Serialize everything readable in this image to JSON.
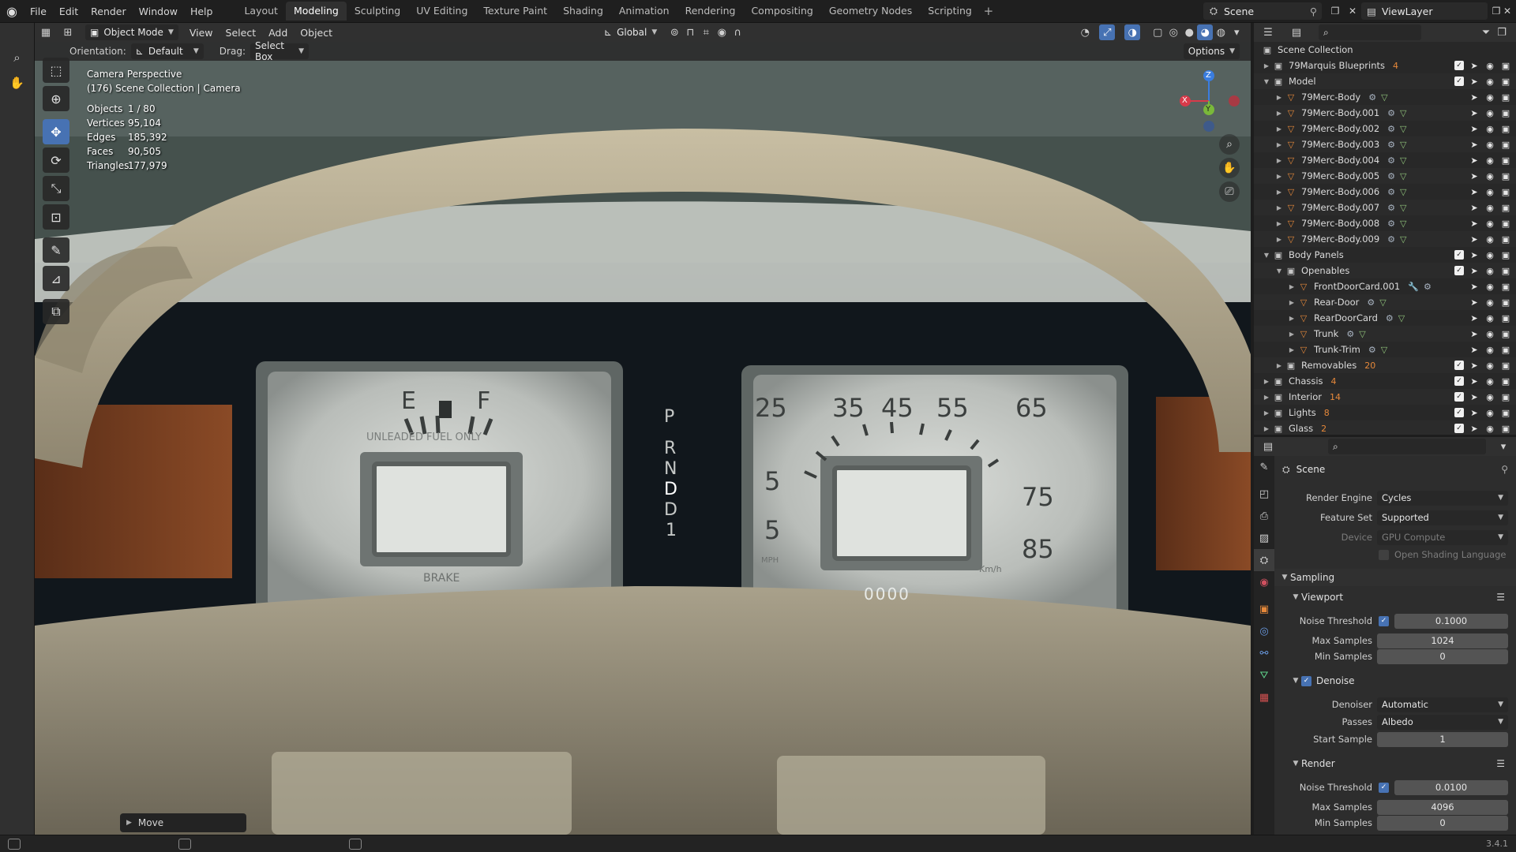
{
  "topbar": {
    "menus": [
      "File",
      "Edit",
      "Render",
      "Window",
      "Help"
    ],
    "workspaces": [
      {
        "label": "Layout",
        "active": false
      },
      {
        "label": "Modeling",
        "active": true
      },
      {
        "label": "Sculpting",
        "active": false
      },
      {
        "label": "UV Editing",
        "active": false
      },
      {
        "label": "Texture Paint",
        "active": false
      },
      {
        "label": "Shading",
        "active": false
      },
      {
        "label": "Animation",
        "active": false
      },
      {
        "label": "Rendering",
        "active": false
      },
      {
        "label": "Compositing",
        "active": false
      },
      {
        "label": "Geometry Nodes",
        "active": false
      },
      {
        "label": "Scripting",
        "active": false
      }
    ],
    "scene_name": "Scene",
    "view_layer": "ViewLayer"
  },
  "viewport_header": {
    "mode": "Object Mode",
    "menus": [
      "View",
      "Select",
      "Add",
      "Object"
    ],
    "transform_orientation": "Global",
    "orientation_label": "Orientation:",
    "orientation_value": "Default",
    "drag_label": "Drag:",
    "drag_value": "Select Box",
    "options_label": "Options"
  },
  "viewport": {
    "camera_line1": "Camera Perspective",
    "camera_line2": "(176) Scene Collection | Camera",
    "stats": [
      {
        "label": "Objects",
        "value": "1 / 80"
      },
      {
        "label": "Vertices",
        "value": "95,104"
      },
      {
        "label": "Edges",
        "value": "185,392"
      },
      {
        "label": "Faces",
        "value": "90,505"
      },
      {
        "label": "Triangles",
        "value": "177,979"
      }
    ],
    "gizmo": {
      "x": "X",
      "y": "Y",
      "z": "Z"
    },
    "last_operator": "Move",
    "dash": {
      "fuel_e": "E",
      "fuel_f": "F",
      "unleaded": "UNLEADED FUEL ONLY",
      "brake": "BRAKE",
      "gears": [
        "P",
        "R",
        "N",
        "D",
        "D",
        "1"
      ],
      "speed_top": [
        "25",
        "35",
        "45",
        "55",
        "65"
      ],
      "speed_left": [
        "5",
        "5"
      ],
      "speed_right": [
        "75",
        "85"
      ],
      "mph": "MPH",
      "kmh": "Km/h",
      "odometer": "0000"
    }
  },
  "outliner": {
    "root": "Scene Collection",
    "rows": [
      {
        "indent": 0,
        "arrow": "right",
        "type": "collection",
        "name": "79Marquis Blueprints",
        "extra": "4",
        "check": true
      },
      {
        "indent": 0,
        "arrow": "down",
        "type": "collection",
        "name": "Model",
        "extra": "",
        "check": true
      },
      {
        "indent": 1,
        "arrow": "right",
        "type": "mesh",
        "name": "79Merc-Body",
        "extra": "mesh",
        "check": false
      },
      {
        "indent": 1,
        "arrow": "right",
        "type": "mesh",
        "name": "79Merc-Body.001",
        "extra": "mesh",
        "check": false
      },
      {
        "indent": 1,
        "arrow": "right",
        "type": "mesh",
        "name": "79Merc-Body.002",
        "extra": "mesh",
        "check": false
      },
      {
        "indent": 1,
        "arrow": "right",
        "type": "mesh",
        "name": "79Merc-Body.003",
        "extra": "mesh",
        "check": false
      },
      {
        "indent": 1,
        "arrow": "right",
        "type": "mesh",
        "name": "79Merc-Body.004",
        "extra": "mesh",
        "check": false
      },
      {
        "indent": 1,
        "arrow": "right",
        "type": "mesh",
        "name": "79Merc-Body.005",
        "extra": "mesh",
        "check": false
      },
      {
        "indent": 1,
        "arrow": "right",
        "type": "mesh",
        "name": "79Merc-Body.006",
        "extra": "mesh",
        "check": false
      },
      {
        "indent": 1,
        "arrow": "right",
        "type": "mesh",
        "name": "79Merc-Body.007",
        "extra": "mesh",
        "check": false
      },
      {
        "indent": 1,
        "arrow": "right",
        "type": "mesh",
        "name": "79Merc-Body.008",
        "extra": "mesh",
        "check": false
      },
      {
        "indent": 1,
        "arrow": "right",
        "type": "mesh",
        "name": "79Merc-Body.009",
        "extra": "mesh",
        "check": false
      },
      {
        "indent": 0,
        "arrow": "down",
        "type": "collection",
        "name": "Body Panels",
        "extra": "",
        "check": true
      },
      {
        "indent": 1,
        "arrow": "down",
        "type": "collection",
        "name": "Openables",
        "extra": "",
        "check": true
      },
      {
        "indent": 2,
        "arrow": "right",
        "type": "mesh",
        "name": "FrontDoorCard.001",
        "extra": "mod",
        "check": false
      },
      {
        "indent": 2,
        "arrow": "right",
        "type": "mesh",
        "name": "Rear-Door",
        "extra": "mesh",
        "check": false
      },
      {
        "indent": 2,
        "arrow": "right",
        "type": "mesh",
        "name": "RearDoorCard",
        "extra": "mesh",
        "check": false
      },
      {
        "indent": 2,
        "arrow": "right",
        "type": "mesh",
        "name": "Trunk",
        "extra": "mesh",
        "check": false
      },
      {
        "indent": 2,
        "arrow": "right",
        "type": "mesh",
        "name": "Trunk-Trim",
        "extra": "mesh",
        "check": false
      },
      {
        "indent": 1,
        "arrow": "right",
        "type": "collection",
        "name": "Removables",
        "extra": "20",
        "check": true
      },
      {
        "indent": 0,
        "arrow": "right",
        "type": "collection",
        "name": "Chassis",
        "extra": "4",
        "check": true
      },
      {
        "indent": 0,
        "arrow": "right",
        "type": "collection",
        "name": "Interior",
        "extra": "14",
        "check": true
      },
      {
        "indent": 0,
        "arrow": "right",
        "type": "collection",
        "name": "Lights",
        "extra": "8",
        "check": true
      },
      {
        "indent": 0,
        "arrow": "right",
        "type": "collection",
        "name": "Glass",
        "extra": "2",
        "check": true
      }
    ]
  },
  "properties": {
    "context": "Scene",
    "render_engine_label": "Render Engine",
    "render_engine": "Cycles",
    "feature_set_label": "Feature Set",
    "feature_set": "Supported",
    "device_label": "Device",
    "device": "GPU Compute",
    "osl_label": "Open Shading Language",
    "sampling": "Sampling",
    "viewport": "Viewport",
    "noise_threshold_label": "Noise Threshold",
    "vp_noise_threshold": "0.1000",
    "max_samples_label": "Max Samples",
    "vp_max_samples": "1024",
    "min_samples_label": "Min Samples",
    "vp_min_samples": "0",
    "denoise": "Denoise",
    "denoiser_label": "Denoiser",
    "denoiser": "Automatic",
    "passes_label": "Passes",
    "passes": "Albedo",
    "start_sample_label": "Start Sample",
    "start_sample": "1",
    "render": "Render",
    "r_noise_threshold": "0.0100",
    "r_max_samples": "4096",
    "r_min_samples": "0"
  },
  "statusbar": {
    "version": "3.4.1"
  },
  "colors": {
    "accent": "#4772b3",
    "mesh_orange": "#e5883a",
    "panel": "#2d2d2d"
  }
}
